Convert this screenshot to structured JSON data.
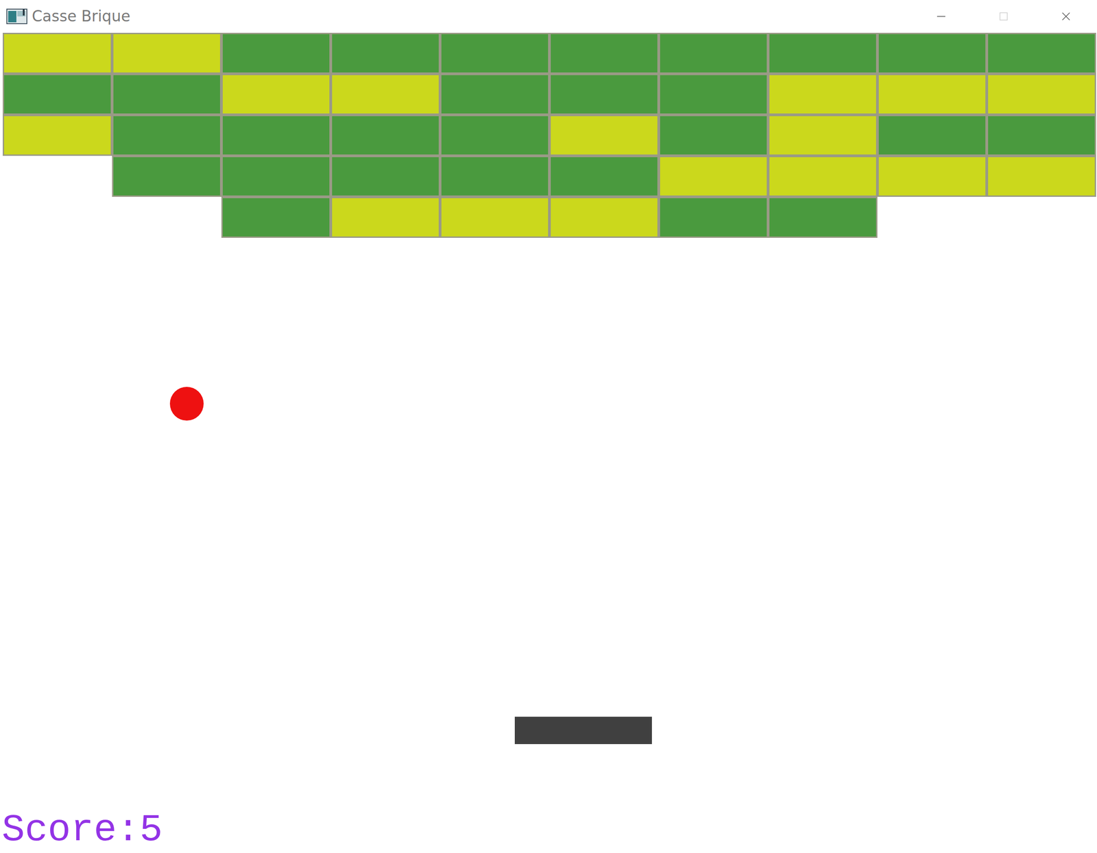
{
  "window": {
    "title": "Casse Brique",
    "controls": [
      {
        "kind": "minimize",
        "disabled": false
      },
      {
        "kind": "maximize",
        "disabled": true
      },
      {
        "kind": "close",
        "disabled": false
      }
    ]
  },
  "bricks": [
    [
      {
        "present": true,
        "color": "#cbd81c"
      },
      {
        "present": true,
        "color": "#cbd81c"
      },
      {
        "present": true,
        "color": "#4a9a3e"
      },
      {
        "present": true,
        "color": "#4a9a3e"
      },
      {
        "present": true,
        "color": "#4a9a3e"
      },
      {
        "present": true,
        "color": "#4a9a3e"
      },
      {
        "present": true,
        "color": "#4a9a3e"
      },
      {
        "present": true,
        "color": "#4a9a3e"
      },
      {
        "present": true,
        "color": "#4a9a3e"
      },
      {
        "present": true,
        "color": "#4a9a3e"
      }
    ],
    [
      {
        "present": true,
        "color": "#4a9a3e"
      },
      {
        "present": true,
        "color": "#4a9a3e"
      },
      {
        "present": true,
        "color": "#cbd81c"
      },
      {
        "present": true,
        "color": "#cbd81c"
      },
      {
        "present": true,
        "color": "#4a9a3e"
      },
      {
        "present": true,
        "color": "#4a9a3e"
      },
      {
        "present": true,
        "color": "#4a9a3e"
      },
      {
        "present": true,
        "color": "#cbd81c"
      },
      {
        "present": true,
        "color": "#cbd81c"
      },
      {
        "present": true,
        "color": "#cbd81c"
      }
    ],
    [
      {
        "present": true,
        "color": "#cbd81c"
      },
      {
        "present": true,
        "color": "#4a9a3e"
      },
      {
        "present": true,
        "color": "#4a9a3e"
      },
      {
        "present": true,
        "color": "#4a9a3e"
      },
      {
        "present": true,
        "color": "#4a9a3e"
      },
      {
        "present": true,
        "color": "#cbd81c"
      },
      {
        "present": true,
        "color": "#4a9a3e"
      },
      {
        "present": true,
        "color": "#cbd81c"
      },
      {
        "present": true,
        "color": "#4a9a3e"
      },
      {
        "present": true,
        "color": "#4a9a3e"
      }
    ],
    [
      {
        "present": false
      },
      {
        "present": true,
        "color": "#4a9a3e"
      },
      {
        "present": true,
        "color": "#4a9a3e"
      },
      {
        "present": true,
        "color": "#4a9a3e"
      },
      {
        "present": true,
        "color": "#4a9a3e"
      },
      {
        "present": true,
        "color": "#4a9a3e"
      },
      {
        "present": true,
        "color": "#cbd81c"
      },
      {
        "present": true,
        "color": "#cbd81c"
      },
      {
        "present": true,
        "color": "#cbd81c"
      },
      {
        "present": true,
        "color": "#cbd81c"
      }
    ],
    [
      {
        "present": false
      },
      {
        "present": false
      },
      {
        "present": true,
        "color": "#4a9a3e"
      },
      {
        "present": true,
        "color": "#cbd81c"
      },
      {
        "present": true,
        "color": "#cbd81c"
      },
      {
        "present": true,
        "color": "#cbd81c"
      },
      {
        "present": true,
        "color": "#4a9a3e"
      },
      {
        "present": true,
        "color": "#4a9a3e"
      },
      {
        "present": false
      },
      {
        "present": false
      }
    ]
  ],
  "score": "Score:5"
}
